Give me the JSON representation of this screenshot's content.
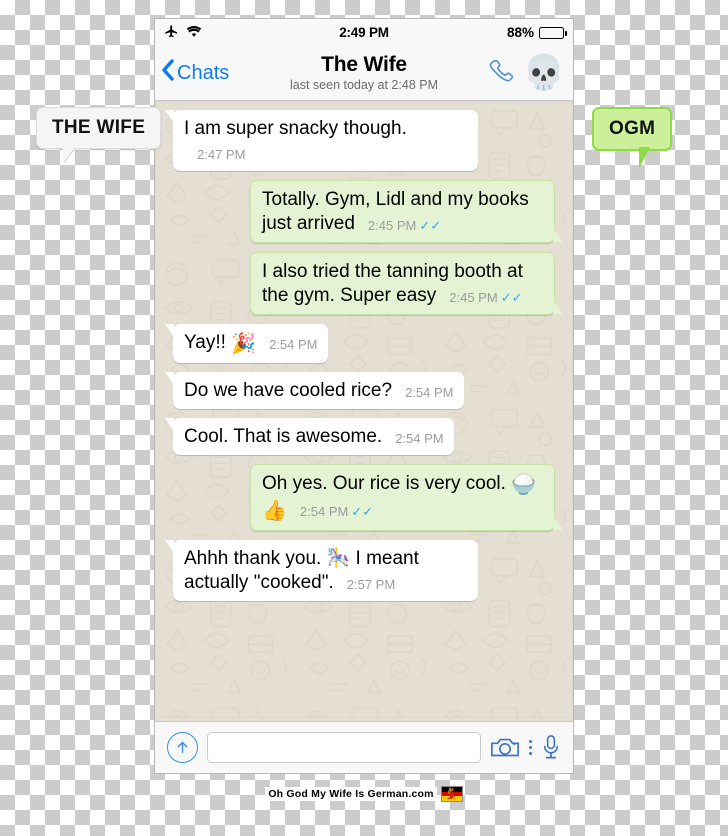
{
  "statusbar": {
    "airplane_icon": "airplane-mode-icon",
    "wifi_icon": "wifi-icon",
    "time": "2:49 PM",
    "battery_percent": "88%",
    "battery_level": 88
  },
  "header": {
    "back_label": "Chats",
    "title": "The Wife",
    "subtitle": "last seen today at 2:48 PM",
    "call_icon": "phone-call-icon",
    "avatar_emoji": "💀"
  },
  "messages": [
    {
      "direction": "in",
      "text": "I am super snacky though.",
      "emoji": "",
      "time": "2:47 PM",
      "ticks": ""
    },
    {
      "direction": "out",
      "text": "Totally. Gym, Lidl and my books just arrived",
      "emoji": "",
      "time": "2:45 PM",
      "ticks": "✓✓"
    },
    {
      "direction": "out",
      "text": "I also tried the tanning booth at the gym. Super easy",
      "emoji": "",
      "time": "2:45 PM",
      "ticks": "✓✓"
    },
    {
      "direction": "in",
      "text": "Yay!! ",
      "emoji": "🎉",
      "time": "2:54 PM",
      "ticks": ""
    },
    {
      "direction": "in",
      "text": "Do we have cooled rice?",
      "emoji": "",
      "time": "2:54 PM",
      "ticks": ""
    },
    {
      "direction": "in",
      "text": "Cool. That is awesome.",
      "emoji": "",
      "time": "2:54 PM",
      "ticks": ""
    },
    {
      "direction": "out",
      "text": "Oh yes. Our rice is very cool. ",
      "emoji": "🍚👍",
      "time": "2:54 PM",
      "ticks": "✓✓"
    },
    {
      "direction": "in",
      "text": "Ahhh thank you. 🎠 I meant actually \"cooked\".",
      "emoji": "",
      "time": "2:57 PM",
      "ticks": ""
    }
  ],
  "inputbar": {
    "attach_icon": "upload-arrow-icon",
    "placeholder": "",
    "value": "",
    "camera_icon": "camera-icon",
    "more_icon": "more-options-icon",
    "mic_icon": "microphone-icon"
  },
  "callouts": {
    "left": "THE WIFE",
    "right": "OGM"
  },
  "footer": {
    "text": "Oh God My Wife Is German.com",
    "flag_icon": "german-flag-icon"
  },
  "colors": {
    "accent_blue": "#0b7bf1",
    "outgoing_bubble": "#e5f3d5",
    "outgoing_border": "#c8e3a7",
    "incoming_bubble": "#ffffff",
    "chat_background": "#e4ded3",
    "tick_blue": "#3fa5e8",
    "callout_green": "#ccf09a",
    "callout_green_border": "#8ddb45"
  }
}
